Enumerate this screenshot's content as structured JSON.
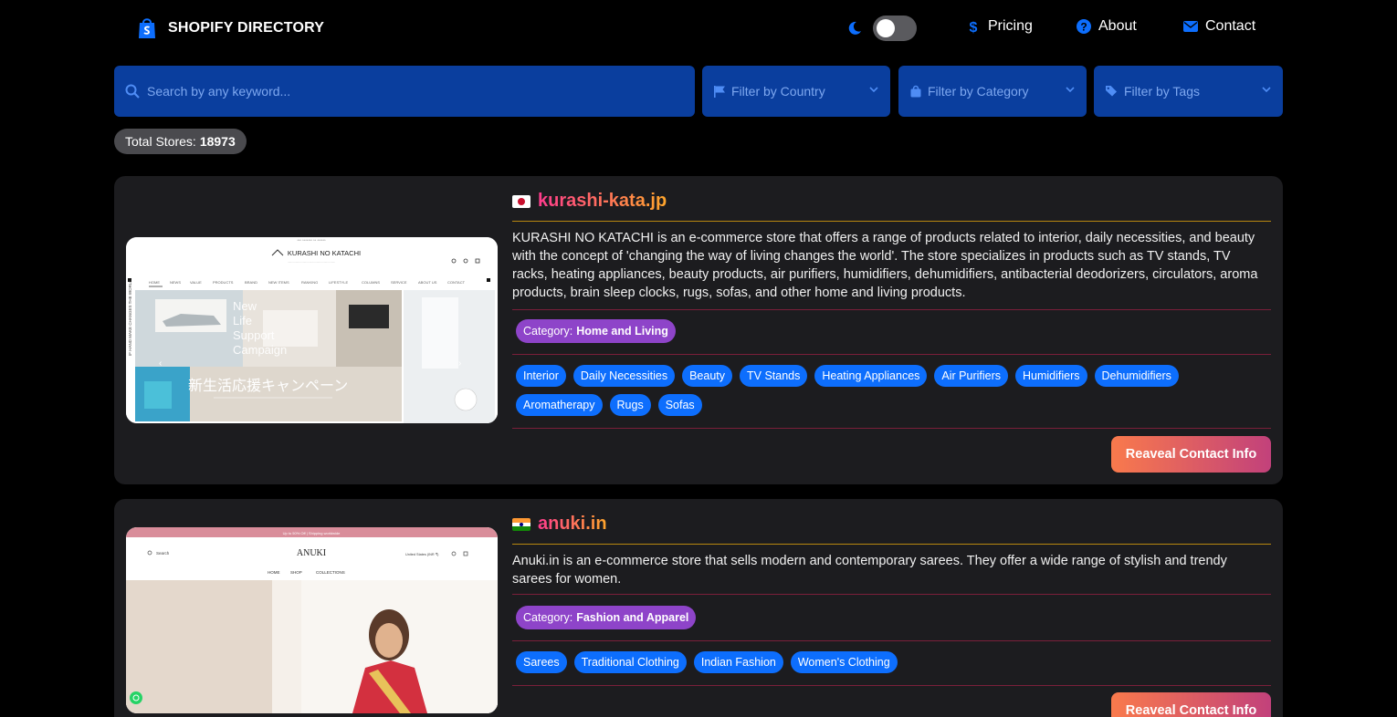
{
  "header": {
    "brand": "SHOPIFY DIRECTORY",
    "nav": [
      {
        "label": "Pricing",
        "icon": "dollar-icon"
      },
      {
        "label": "About",
        "icon": "question-circle-icon"
      },
      {
        "label": "Contact",
        "icon": "envelope-icon"
      }
    ]
  },
  "filters": {
    "search_placeholder": "Search by any keyword...",
    "country": "Filter by Country",
    "category": "Filter by Category",
    "tags": "Filter by Tags"
  },
  "total": {
    "label": "Total Stores:",
    "value": "18973"
  },
  "stores": [
    {
      "flag": "jp-flag",
      "domain": "kurashi-kata.jp",
      "description": "KURASHI NO KATACHI is an e-commerce store that offers a range of products related to interior, daily necessities, and beauty with the concept of 'changing the way of living changes the world'. The store specializes in products such as TV stands, TV racks, heating appliances, beauty products, air purifiers, humidifiers, dehumidifiers, antibacterial deodorizers, circulators, aroma products, brain sleep clocks, rugs, sofas, and other home and living products.",
      "category_label": "Category:",
      "category": "Home and Living",
      "tags": [
        "Interior",
        "Daily Necessities",
        "Beauty",
        "TV Stands",
        "Heating Appliances",
        "Air Purifiers",
        "Humidifiers",
        "Dehumidifiers",
        "Aromatherapy",
        "Rugs",
        "Sofas"
      ],
      "button": "Reaveal Contact Info",
      "screenshot": {
        "logo": "KURASHI NO KATACHI",
        "nav": [
          "HOME",
          "NEWS",
          "VALUE",
          "PRODUCTS",
          "BRAND",
          "NEW ITEMS",
          "RANKING",
          "LIFESTYLE",
          "COLUMNS",
          "SERVICE",
          "ABOUT US",
          "CONTACT"
        ],
        "banner_en": [
          "New",
          "Life",
          "Support",
          "Campaign"
        ],
        "banner_jp": "新生活応援キャンペーン"
      }
    },
    {
      "flag": "in-flag",
      "domain": "anuki.in",
      "description": "Anuki.in is an e-commerce store that sells modern and contemporary sarees. They offer a wide range of stylish and trendy sarees for women.",
      "category_label": "Category:",
      "category": "Fashion and Apparel",
      "tags": [
        "Sarees",
        "Traditional Clothing",
        "Indian Fashion",
        "Women's Clothing"
      ],
      "button": "Reaveal Contact Info",
      "screenshot": {
        "logo": "ANUKI",
        "search": "Search",
        "nav": [
          "HOME",
          "SHOP",
          "COLLECTIONS"
        ]
      }
    }
  ]
}
